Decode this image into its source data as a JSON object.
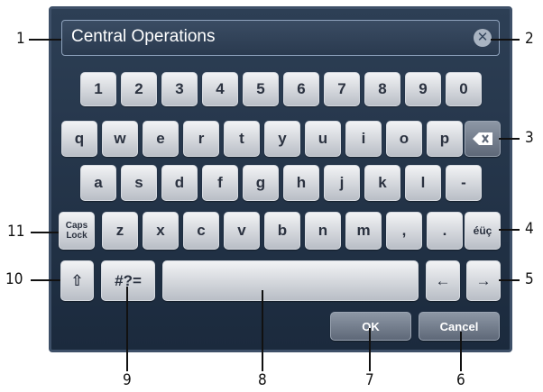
{
  "input": {
    "value": "Central Operations",
    "clear_icon": "✕"
  },
  "rows": {
    "numbers": [
      "1",
      "2",
      "3",
      "4",
      "5",
      "6",
      "7",
      "8",
      "9",
      "0"
    ],
    "row_q": [
      "q",
      "w",
      "e",
      "r",
      "t",
      "y",
      "u",
      "i",
      "o",
      "p"
    ],
    "row_a": [
      "a",
      "s",
      "d",
      "f",
      "g",
      "h",
      "j",
      "k",
      "l",
      "-"
    ],
    "row_z": [
      "z",
      "x",
      "c",
      "v",
      "b",
      "n",
      "m",
      ",",
      "."
    ]
  },
  "keys": {
    "backspace_icon": "backspace-icon",
    "caps_lock": "Caps\nLock",
    "accents": "éüç",
    "shift_icon": "⇧",
    "symbols": "#?=",
    "left_arrow": "←",
    "right_arrow": "→",
    "ok": "OK",
    "cancel": "Cancel"
  },
  "callouts": [
    "1",
    "2",
    "3",
    "4",
    "5",
    "6",
    "7",
    "8",
    "9",
    "10",
    "11"
  ]
}
